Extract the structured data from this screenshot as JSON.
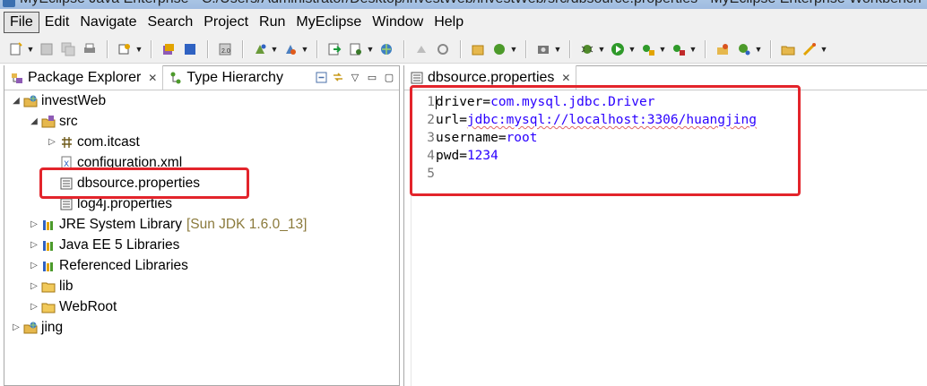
{
  "window": {
    "title": "MyEclipse Java Enterprise - C:/Users/Administrator/Desktop/investWeb/investWeb/src/dbsource.properties - MyEclipse Enterprise Workbench"
  },
  "menu": [
    {
      "label": "File",
      "mnemonic": "F"
    },
    {
      "label": "Edit",
      "mnemonic": "E"
    },
    {
      "label": "Navigate",
      "mnemonic": "N"
    },
    {
      "label": "Search",
      "mnemonic": "a"
    },
    {
      "label": "Project",
      "mnemonic": "P"
    },
    {
      "label": "Run",
      "mnemonic": "R"
    },
    {
      "label": "MyEclipse",
      "mnemonic": "y"
    },
    {
      "label": "Window",
      "mnemonic": "W"
    },
    {
      "label": "Help",
      "mnemonic": "H"
    }
  ],
  "left_panel": {
    "tabs": [
      {
        "label": "Package Explorer",
        "icon": "package-explorer-icon"
      },
      {
        "label": "Type Hierarchy",
        "icon": "type-hierarchy-icon"
      }
    ],
    "tree": [
      {
        "label": "investWeb",
        "icon": "web-project-icon",
        "expanded": true,
        "level": 0
      },
      {
        "label": "src",
        "icon": "source-folder-icon",
        "expanded": true,
        "level": 1
      },
      {
        "label": "com.itcast",
        "icon": "package-icon",
        "expanded": false,
        "level": 2
      },
      {
        "label": "configuration.xml",
        "icon": "xml-file-icon",
        "level": 2
      },
      {
        "label": "dbsource.properties",
        "icon": "properties-file-icon",
        "level": 2,
        "selected": true
      },
      {
        "label": "log4j.properties",
        "icon": "properties-file-icon",
        "level": 2
      },
      {
        "label": "JRE System Library",
        "extra": "[Sun JDK 1.6.0_13]",
        "icon": "library-icon",
        "expanded": false,
        "level": 1
      },
      {
        "label": "Java EE 5 Libraries",
        "icon": "library-icon",
        "expanded": false,
        "level": 1
      },
      {
        "label": "Referenced Libraries",
        "icon": "library-icon",
        "expanded": false,
        "level": 1
      },
      {
        "label": "lib",
        "icon": "folder-icon",
        "expanded": false,
        "level": 1
      },
      {
        "label": "WebRoot",
        "icon": "folder-icon",
        "expanded": false,
        "level": 1
      },
      {
        "label": "jing",
        "icon": "web-project-icon",
        "expanded": false,
        "level": 0
      }
    ]
  },
  "editor": {
    "tab_label": "dbsource.properties",
    "lines": [
      {
        "num": "1",
        "key": "driver",
        "value": "com.mysql.jdbc.Driver"
      },
      {
        "num": "2",
        "key": "url",
        "value": "jdbc:mysql://localhost:3306/huangjing"
      },
      {
        "num": "3",
        "key": "username",
        "value": "root"
      },
      {
        "num": "4",
        "key": "pwd",
        "value": "1234"
      },
      {
        "num": "5",
        "key": "",
        "value": ""
      }
    ]
  },
  "colors": {
    "highlight_box": "#e3242b",
    "value_text": "#2a00ff"
  }
}
